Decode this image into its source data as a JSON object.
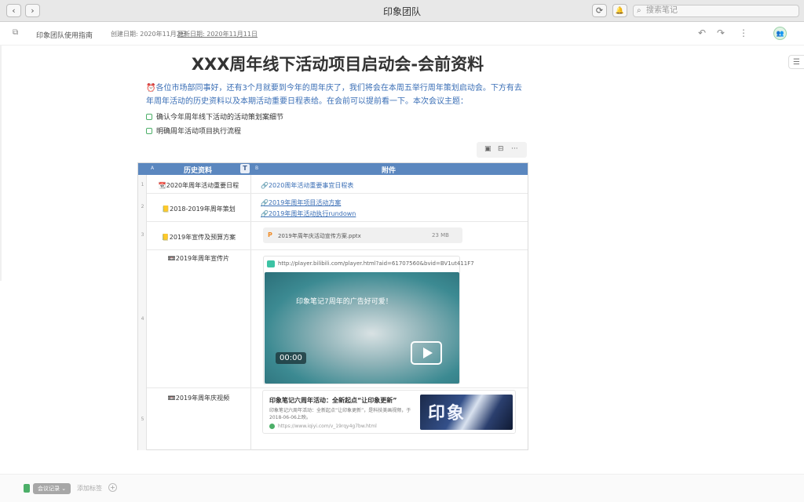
{
  "window": {
    "title": "印象团队",
    "back_icon": "‹",
    "forward_icon": "›",
    "sync_icon": "⟳",
    "bell_icon": "🔔"
  },
  "search": {
    "placeholder": "搜索笔记",
    "icon": "⌕"
  },
  "toolbar": {
    "notebook": "印象团队使用指南",
    "created": "创建日期: 2020年11月2日",
    "updated": "更新日期: 2020年11月11日",
    "undo": "↶",
    "redo": "↷",
    "more": "⋮",
    "sidebar_icon": "⧉",
    "avatar_icon": "👥"
  },
  "outline": {
    "icon": "☰"
  },
  "doc": {
    "title": "XXX周年线下活动项目启动会-会前资料",
    "intro": "⏰各位市场部同事好，还有3个月就要到今年的周年庆了，我们将会在本周五举行周年策划启动会。下方有去年周年活动的历史资料以及本期活动重要日程表给。在会前可以提前看一下。本次会议主题：",
    "todos": [
      "确认今年周年线下活动的活动策划案细节",
      "明确周年活动项目执行流程"
    ]
  },
  "table_tools": {
    "image": "▣",
    "grid": "⊟",
    "more": "···"
  },
  "table": {
    "col_letters": [
      "A",
      "B"
    ],
    "headers": [
      "历史资料",
      "附件"
    ],
    "type_badge": "T",
    "rows": [
      {
        "num": "1",
        "a": "📆2020年周年活动重要日程",
        "b": [
          "🔗2020周年活动重要事宜日程表"
        ]
      },
      {
        "num": "2",
        "a": "📒2018-2019年周年策划",
        "b": [
          "🔗2019年周年项目活动方案",
          "🔗2019年周年活动执行rundown"
        ]
      },
      {
        "num": "3",
        "a": "📒2019年宣传及预算方案",
        "file": {
          "icon": "P",
          "name": "2019年周年庆活动宣传方案.pptx",
          "size": "23 MB"
        }
      },
      {
        "num": "4",
        "a": "📼2019年周年宣传片",
        "video": {
          "url": "http://player.bilibili.com/player.html?aid=61707560&bvid=BV1ut411F7",
          "caption": "印象笔记7周年的广告好可爱！",
          "time": "00:00"
        }
      },
      {
        "num": "5",
        "a": "📼2019年周年庆视频",
        "link": {
          "title": "印象笔记六周年活动：全新起点“让印象更新”",
          "desc": "印象笔记六周年活动：全新起点“让印象更新”，是科技美画视频，于2018-06-06上映。",
          "url": "https://www.iqiyi.com/v_19rqy4g7bw.html",
          "thumb_text": "印象"
        }
      }
    ]
  },
  "bottom": {
    "tag": "会议记录 ⌄",
    "add_tag": "添加标签",
    "plus": "+"
  }
}
